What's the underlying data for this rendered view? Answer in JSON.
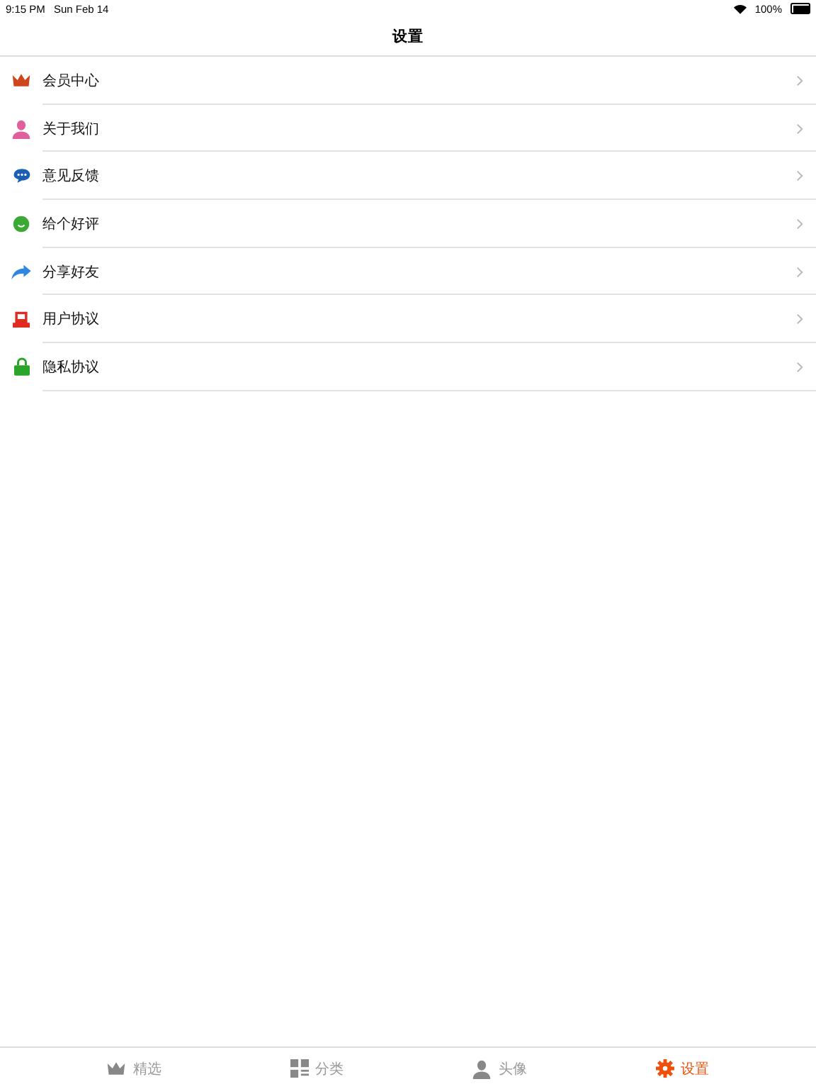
{
  "status_bar": {
    "time": "9:15 PM",
    "date": "Sun Feb 14",
    "battery": "100%"
  },
  "nav": {
    "title": "设置"
  },
  "items": [
    {
      "label": "会员中心",
      "kind": "crown"
    },
    {
      "label": "关于我们",
      "kind": "person"
    },
    {
      "label": "意见反馈",
      "kind": "chat"
    },
    {
      "label": "给个好评",
      "kind": "smile"
    },
    {
      "label": "分享好友",
      "kind": "share"
    },
    {
      "label": "用户协议",
      "kind": "book"
    },
    {
      "label": "隐私协议",
      "kind": "lock"
    }
  ],
  "tabs": [
    {
      "label": "精选",
      "kind": "crown",
      "selected": false
    },
    {
      "label": "分类",
      "kind": "grid",
      "selected": false
    },
    {
      "label": "头像",
      "kind": "person",
      "selected": false
    },
    {
      "label": "设置",
      "kind": "gear",
      "selected": true
    }
  ]
}
